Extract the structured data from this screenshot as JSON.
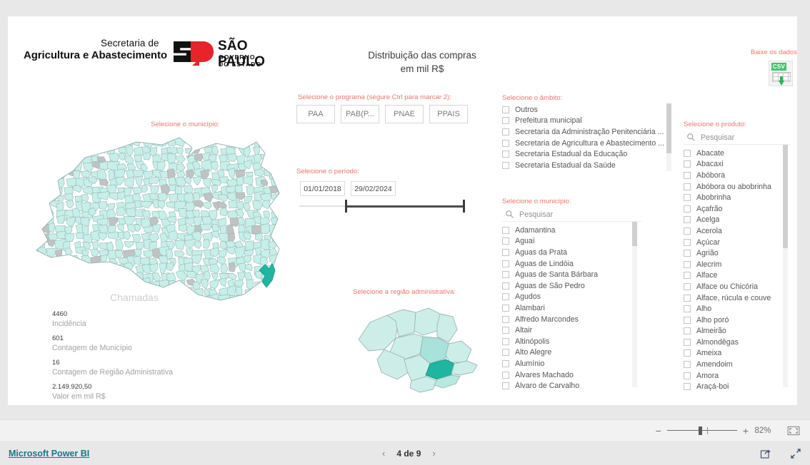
{
  "header": {
    "logo": {
      "line_small": "Secretaria de",
      "line_big": "Agricultura e Abastecimento",
      "state_title": "SÃO PAULO",
      "state_sub": "GOVERNO DO ESTADO"
    },
    "title": "Distribuição das compras\nem mil R$",
    "title_line1": "Distribuição das compras",
    "title_line2": "em mil R$",
    "download_label": "Baixe os dados",
    "csv_tag": "CSV"
  },
  "program_slicer": {
    "title": "Selecione o programa (segure Ctrl para marcar 2):",
    "buttons": [
      "PAA",
      "PAB(P...",
      "PNAE",
      "PPAIS"
    ]
  },
  "period_slicer": {
    "title": "Selecione o período:",
    "start": "01/01/2018",
    "end": "29/02/2024"
  },
  "ambito_slicer": {
    "title": "Selecione o âmbito:",
    "items": [
      "Outros",
      "Prefeitura municipal",
      "Secretaria da Administração Penitenciária ...",
      "Secretaria de Agricultura e Abastecimento ...",
      "Secretaria Estadual da Educação",
      "Secretaria Estadual da Saúde"
    ]
  },
  "municipio_slicer": {
    "title": "Selecione o município:",
    "search_placeholder": "Pesquisar",
    "items": [
      "Adamantina",
      "Aguaí",
      "Águas da Prata",
      "Águas de Lindóia",
      "Águas de Santa Bárbara",
      "Águas de São Pedro",
      "Agudos",
      "Alambari",
      "Alfredo Marcondes",
      "Altair",
      "Altinópolis",
      "Alto Alegre",
      "Alumínio",
      "Álvares Machado",
      "Álvaro de Carvalho"
    ]
  },
  "produto_slicer": {
    "title": "Selecione o produto:",
    "search_placeholder": "Pesquisar",
    "items": [
      "Abacate",
      "Abacaxi",
      "Abóbora",
      "Abóbora ou abobrinha",
      "Abobrinha",
      "Açafrão",
      "Acelga",
      "Acerola",
      "Açúcar",
      "Agrião",
      "Alecrim",
      "Alface",
      "Alface ou Chicória",
      "Alface, rúcula e couve",
      "Alho",
      "Alho poró",
      "Almeirão",
      "Almondêgas",
      "Ameixa",
      "Amendoim",
      "Amora",
      "Araçá-boi"
    ]
  },
  "map_municipio": {
    "title": "Selecione o município:"
  },
  "map_regiao": {
    "title": "Selecione a região administrativa:"
  },
  "stats_card": {
    "heading": "Chamadas",
    "rows": [
      {
        "value": "4460",
        "caption": "Incidência"
      },
      {
        "value": "601",
        "caption": "Contagem de Município"
      },
      {
        "value": "16",
        "caption": "Contagem de Região Administrativa"
      },
      {
        "value": "2.149.920,50",
        "caption": "Valor em mil R$"
      }
    ]
  },
  "zoom_bar": {
    "minus": "−",
    "plus": "+",
    "percent": "82%",
    "fit_icon": "fit-to-page-icon"
  },
  "status_bar": {
    "brand": "Microsoft Power BI",
    "prev": "‹",
    "next": "›",
    "page_label": "4 de 9",
    "share_icon": "share-icon",
    "fullscreen_icon": "fullscreen-icon"
  },
  "colors": {
    "accent_label": "#f0756c",
    "map_fill": "#c6efe9",
    "map_stroke": "#9ab5b2",
    "map_inactive": "#c2c2c2",
    "map_highlight": "#1fb5a0",
    "brand_red": "#e8232a",
    "link": "#137a86"
  }
}
